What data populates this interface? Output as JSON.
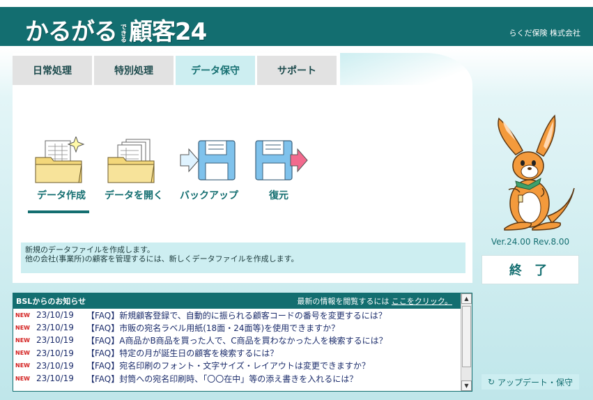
{
  "header": {
    "logo_main": "かるがる",
    "logo_small": "できる",
    "logo_tail": "顧客24",
    "company": "らくだ保険 株式会社"
  },
  "tabs": [
    {
      "label": "日常処理"
    },
    {
      "label": "特別処理"
    },
    {
      "label": "データ保守"
    },
    {
      "label": "サポート"
    }
  ],
  "active_tab": 2,
  "actions": [
    {
      "label": "データ作成",
      "icon": "new-folder-icon"
    },
    {
      "label": "データを開く",
      "icon": "open-folder-icon"
    },
    {
      "label": "バックアップ",
      "icon": "backup-disk-icon"
    },
    {
      "label": "復元",
      "icon": "restore-disk-icon"
    }
  ],
  "description": {
    "line1": "新規のデータファイルを作成します。",
    "line2": "他の会社(事業所)の顧客を管理するには、新しくデータファイルを作成します。"
  },
  "sidebar": {
    "version": "Ver.24.00 Rev.8.00",
    "exit_label": "終 了",
    "update_label": "アップデート・保守",
    "update_icon": "refresh-icon",
    "mascot": "kangaroo-mascot"
  },
  "news": {
    "title": "BSLからのお知らせ",
    "link_prefix": "最新の情報を閲覧するには",
    "link_text": "ここをクリック。",
    "items": [
      {
        "badge": "NEW",
        "date": "23/10/19",
        "text": "【FAQ】新規顧客登録で、自動的に振られる顧客コードの番号を変更するには？"
      },
      {
        "badge": "NEW",
        "date": "23/10/19",
        "text": "【FAQ】市販の宛名ラベル用紙(18面・24面等)を使用できますか？"
      },
      {
        "badge": "NEW",
        "date": "23/10/19",
        "text": "【FAQ】A商品かB商品を買った人で、C商品を買わなかった人を検索するには？"
      },
      {
        "badge": "NEW",
        "date": "23/10/19",
        "text": "【FAQ】特定の月が誕生日の顧客を検索するには？"
      },
      {
        "badge": "NEW",
        "date": "23/10/19",
        "text": "【FAQ】宛名印刷のフォント・文字サイズ・レイアウトは変更できますか？"
      },
      {
        "badge": "NEW",
        "date": "23/10/19",
        "text": "【FAQ】封筒への宛名印刷時、「〇〇在中」等の添え書きを入れるには？"
      }
    ]
  },
  "colors": {
    "brand": "#136e70",
    "tab_active": "#cdeef1",
    "tab_inactive": "#e2e2e2",
    "news_badge": "#d3201f"
  }
}
